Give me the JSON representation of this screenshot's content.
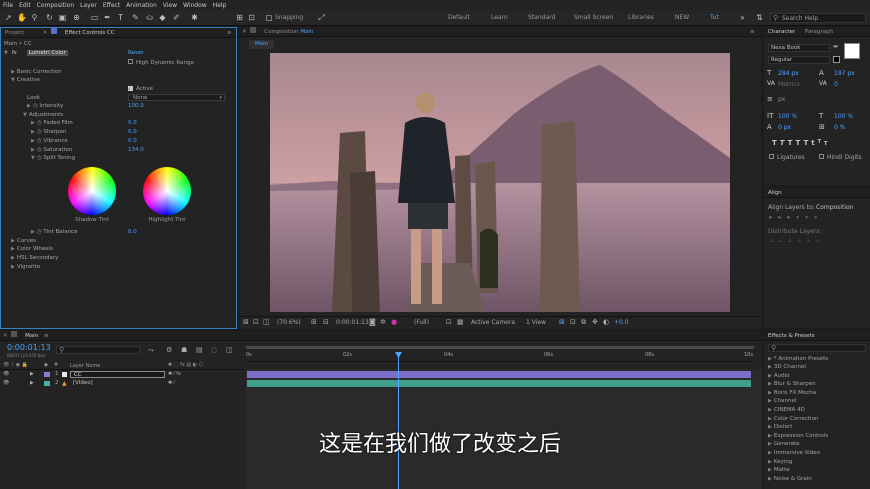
{
  "menubar": {
    "items": [
      "File",
      "Edit",
      "Composition",
      "Layer",
      "Effect",
      "Animation",
      "View",
      "Window",
      "Help"
    ]
  },
  "toolbar": {
    "snapping_label": "Snapping",
    "workspaces": [
      "Default",
      "Learn",
      "Standard",
      "Small Screen",
      "Libraries",
      "NEW",
      "Tut"
    ],
    "active_workspace": "Tut",
    "search_placeholder": "Search Help"
  },
  "left_panel": {
    "tabs": [
      "Project",
      "Effect Controls CC"
    ],
    "crumb": "Main • CC",
    "effect": {
      "name": "Lumetri Color",
      "reset": "Reset",
      "hdr": "High Dynamic Range",
      "basic_correction": "Basic Correction",
      "creative": "Creative",
      "active_label": "Active",
      "look_label": "Look",
      "look_value": "None",
      "intensity_label": "Intensity",
      "intensity_value": "100.0",
      "adjustments": "Adjustments",
      "faded_film_label": "Faded Film",
      "faded_film_value": "0.0",
      "sharpen_label": "Sharpen",
      "sharpen_value": "0.0",
      "vibrance_label": "Vibrance",
      "vibrance_value": "0.0",
      "saturation_label": "Saturation",
      "saturation_value": "134.0",
      "split_toning": "Split Toning",
      "shadow_tint": "Shadow Tint",
      "highlight_tint": "Highlight Tint",
      "tint_balance_label": "Tint Balance",
      "tint_balance_value": "0.0",
      "sections": [
        "Curves",
        "Color Wheels",
        "HSL Secondary",
        "Vignette"
      ]
    }
  },
  "composition": {
    "tab": "Composition",
    "comp_name": "Main",
    "sub_tab": "Main",
    "bottom_bar": {
      "zoom": "(70.6%)",
      "timecode": "0:00:01:13",
      "resolution": "(Full)",
      "camera": "Active Camera",
      "view": "1 View",
      "exposure": "+0.0"
    }
  },
  "character_panel": {
    "tabs": [
      "Character",
      "Paragraph"
    ],
    "font": "Nexa Book",
    "style": "Regular",
    "size": "284 px",
    "leading": "197 px",
    "kerning": "Metrics",
    "tracking": "0",
    "stroke": "px",
    "vscale": "100 %",
    "hscale": "100 %",
    "baseline": "0 px",
    "tsume": "0 %",
    "ligatures": "Ligatures",
    "hindi": "Hindi Digits",
    "style_buttons": [
      "T",
      "T",
      "TT",
      "Tt",
      "T",
      "T"
    ]
  },
  "align_panel": {
    "title": "Align",
    "align_to_label": "Align Layers to:",
    "align_to_value": "Composition",
    "distribute_label": "Distribute Layers:"
  },
  "effects_panel": {
    "title": "Effects & Presets",
    "items": [
      "* Animation Presets",
      "3D Channel",
      "Audio",
      "Blur & Sharpen",
      "Boris FX Mocha",
      "Channel",
      "CINEMA 4D",
      "Color Correction",
      "Distort",
      "Expression Controls",
      "Generate",
      "Immersive Video",
      "Keying",
      "Matte",
      "Noise & Grain"
    ]
  },
  "timeline": {
    "tab": "Main",
    "timecode": "0:00:01:13",
    "fps": "00037 (23.976 fps)",
    "col_layer_name": "Layer Name",
    "layers": [
      {
        "num": "1",
        "name": "CC",
        "color": "#8f79d8"
      },
      {
        "num": "2",
        "name": "[Video]",
        "color": "#3fb5a7"
      }
    ],
    "ruler": [
      "0s",
      "02s",
      "04s",
      "06s",
      "08s",
      "10s"
    ]
  },
  "subtitle": "这是在我们做了改变之后",
  "colors": {
    "accent": "#4da3ff",
    "layer1_bar": "#7b6fc9",
    "layer2_bar": "#3f9e8c",
    "playhead": "#4da3ff"
  }
}
